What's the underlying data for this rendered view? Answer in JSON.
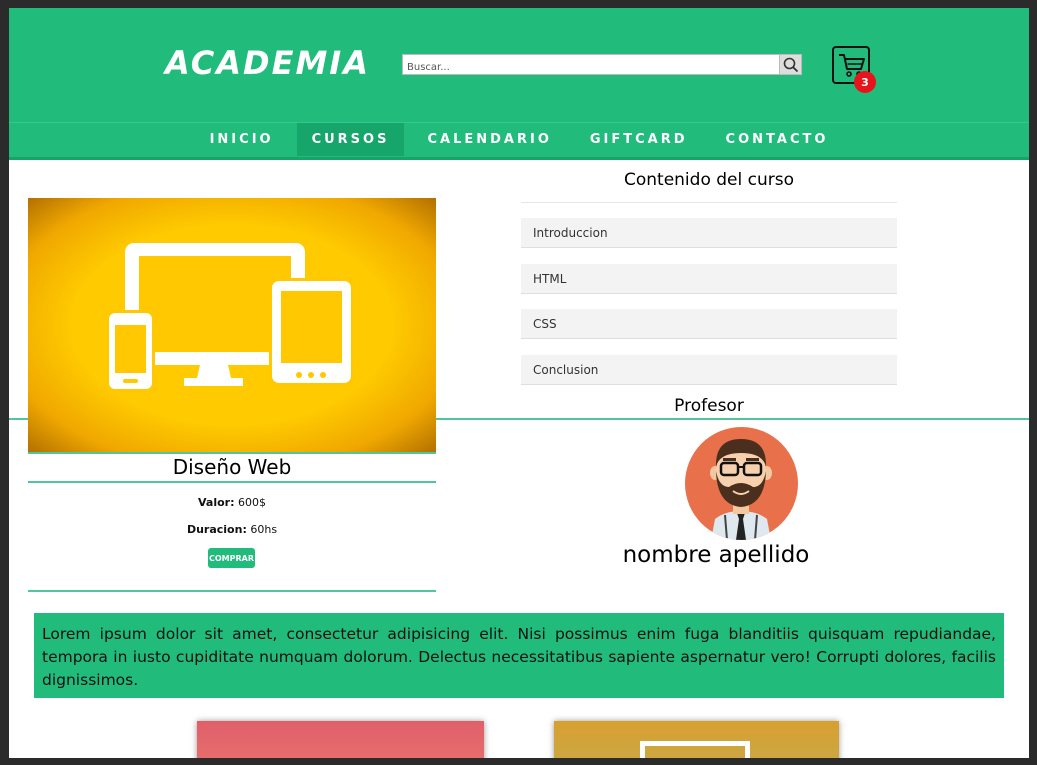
{
  "header": {
    "logo": "ACADEMIA",
    "search_placeholder": "Buscar...",
    "cart_count": "3"
  },
  "nav": {
    "items": [
      {
        "label": "INICIO"
      },
      {
        "label": "CURSOS",
        "active": true
      },
      {
        "label": "CALENDARIO"
      },
      {
        "label": "GIFTCARD"
      },
      {
        "label": "CONTACTO"
      }
    ]
  },
  "course": {
    "title": "Diseño Web",
    "price_label": "Valor:",
    "price_value": "600$",
    "duration_label": "Duracion:",
    "duration_value": "60hs",
    "buy_label": "COMPRAR",
    "image_icon": "devices-icon"
  },
  "content": {
    "title": "Contenido del curso",
    "lessons": [
      {
        "label": "Introduccion"
      },
      {
        "label": "HTML"
      },
      {
        "label": "CSS"
      },
      {
        "label": "Conclusion"
      }
    ]
  },
  "teacher": {
    "title": "Profesor",
    "name": "nombre apellido",
    "avatar_icon": "bearded-man-avatar"
  },
  "description": "Lorem ipsum dolor sit amet, consectetur adipisicing elit. Nisi possimus enim fuga blanditiis quisquam repudiandae, tempora in iusto cupiditate numquam dolorum. Delectus necessitatibus sapiente aspernatur vero! Corrupti dolores, facilis dignissimos.",
  "colors": {
    "brand_green": "#21bb7c",
    "active_nav": "#16a56a",
    "badge_red": "#e8141b",
    "course_yellow": "#ffcb00",
    "avatar_bg": "#e8704a"
  }
}
